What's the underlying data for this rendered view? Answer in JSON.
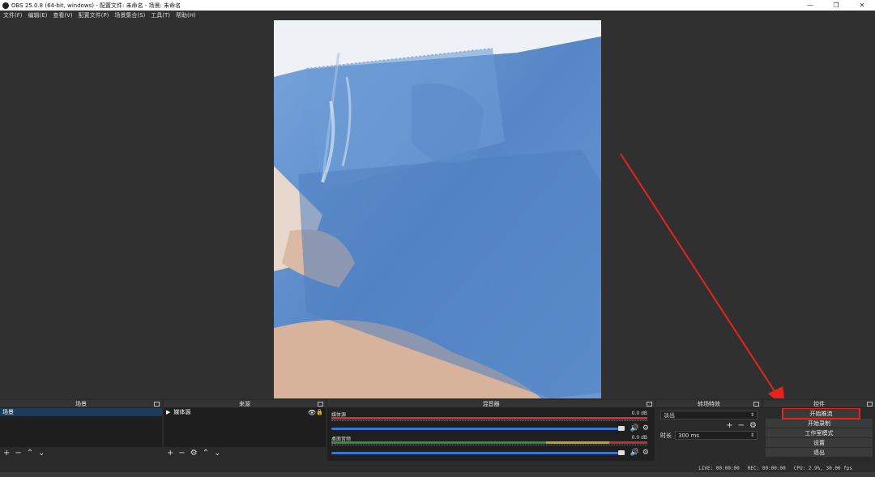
{
  "window": {
    "title": "OBS 25.0.8 (64-bit, windows) - 配置文件: 未命名 - 场景: 未命名",
    "min": "—",
    "max": "❐",
    "close": "✕"
  },
  "menu": [
    "文件(F)",
    "编辑(E)",
    "查看(V)",
    "配置文件(P)",
    "场景集合(S)",
    "工具(T)",
    "帮助(H)"
  ],
  "docks": {
    "scenes": {
      "title": "场景",
      "items": [
        "场景"
      ]
    },
    "sources": {
      "title": "来源",
      "items": [
        "媒体源"
      ]
    },
    "mixer": {
      "title": "混音器",
      "channels": [
        {
          "name": "媒体源",
          "db": "0.0 dB"
        },
        {
          "name": "桌面音频",
          "db": "0.0 dB"
        }
      ]
    },
    "transitions": {
      "title": "转场特效",
      "type": "淡出",
      "duration_label": "时长",
      "duration": "300 ms"
    },
    "controls": {
      "title": "控件",
      "buttons": [
        "开始推流",
        "开始录制",
        "工作室模式",
        "设置",
        "退出"
      ]
    }
  },
  "status": {
    "live": "LIVE: 00:00:00",
    "rec": "REC: 00:00:00",
    "cpu": "CPU: 2.9%, 30.00 fps"
  },
  "annotation": {
    "color": "#e8231c"
  }
}
